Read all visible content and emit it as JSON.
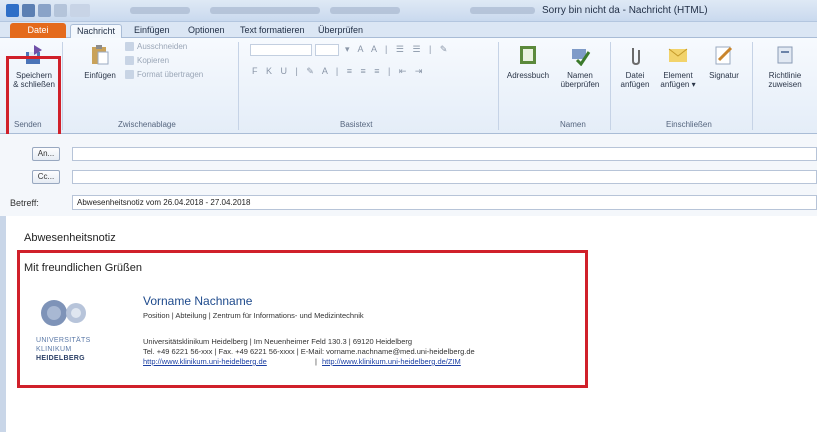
{
  "window": {
    "title": "Sorry bin nicht da - Nachricht (HTML)"
  },
  "tabs": [
    {
      "label": "Datei"
    },
    {
      "label": "Nachricht"
    },
    {
      "label": "Einfügen"
    },
    {
      "label": "Optionen"
    },
    {
      "label": "Text formatieren"
    },
    {
      "label": "Überprüfen"
    }
  ],
  "ribbon": {
    "save": {
      "label1": "Speichern",
      "label2": "& schließen",
      "group": "Senden"
    },
    "paste": {
      "label": "Einfügen"
    },
    "clipboard": {
      "cut": "Ausschneiden",
      "copy": "Kopieren",
      "format": "Format übertragen",
      "group": "Zwischenablage"
    },
    "text_group": "Basistext",
    "addressbook": {
      "label": "Adressbuch"
    },
    "checknames": {
      "label1": "Namen",
      "label2": "überprüfen"
    },
    "names_group": "Namen",
    "attach_file": {
      "label1": "Datei",
      "label2": "anfügen"
    },
    "attach_item": {
      "label1": "Element",
      "label2": "anfügen ▾"
    },
    "signature": {
      "label": "Signatur"
    },
    "include_group": "Einschließen",
    "policy": {
      "label1": "Richtlinie",
      "label2": "zuweisen"
    }
  },
  "fields": {
    "to_label": "An...",
    "cc_label": "Cc...",
    "subject_label": "Betreff:",
    "subject_value": "Abwesenheitsnotiz vom 26.04.2018 - 27.04.2018"
  },
  "body": {
    "heading": "Abwesenheitsnotiz",
    "greeting": "Mit freundlichen Grüßen"
  },
  "signature": {
    "name": "Vorname Nachname",
    "position": "Position | Abteilung | Zentrum für Informations- und Medizintechnik",
    "address": "Universitätsklinikum Heidelberg | Im Neuenheimer Feld 130.3 | 69120 Heidelberg",
    "contact": "Tel. +49 6221 56-xxx | Fax. +49 6221 56-xxxx | E-Mail: vorname.nachname@med.uni-heidelberg.de",
    "link1": "http://www.klinikum.uni-heidelberg.de",
    "separator": "|",
    "link2": "http://www.klinikum.uni-heidelberg.de/ZIM",
    "logo_line1": "UNIVERSITÄTS",
    "logo_line2": "KLINIKUM",
    "logo_line3": "HEIDELBERG"
  },
  "colors": {
    "highlight": "#d0202a",
    "file_tab": "#e46a1c",
    "signature_name": "#1e4a8c"
  }
}
